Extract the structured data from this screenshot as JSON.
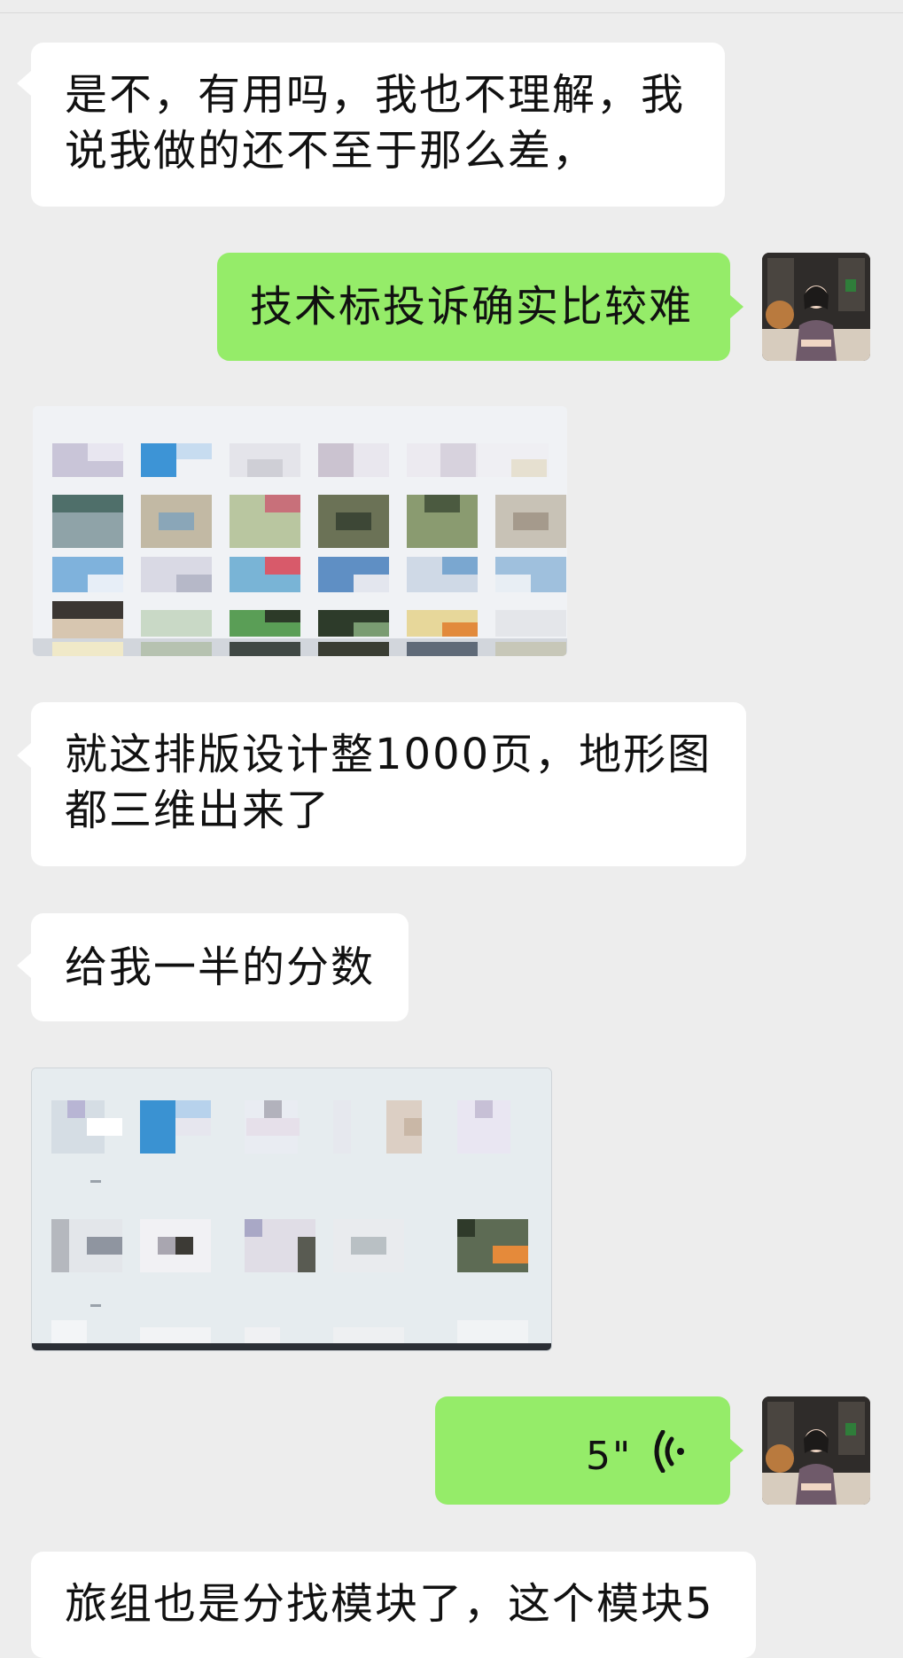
{
  "messages": [
    {
      "side": "in",
      "type": "text",
      "lines": [
        "是不，有用吗，我也不理解，我",
        "说我做的还不至于那么差，"
      ]
    },
    {
      "side": "out",
      "type": "text",
      "lines": [
        "技术标投诉确实比较难"
      ]
    },
    {
      "side": "in",
      "type": "image"
    },
    {
      "side": "in",
      "type": "text",
      "lines": [
        "就这排版设计整1000页，地形图",
        "都三维出来了"
      ]
    },
    {
      "side": "in",
      "type": "text",
      "lines": [
        "给我一半的分数"
      ]
    },
    {
      "side": "in",
      "type": "image"
    },
    {
      "side": "out",
      "type": "voice",
      "duration": "5\""
    },
    {
      "side": "in",
      "type": "text",
      "lines": [
        "旅组也是分找模块了，这个模块5"
      ]
    }
  ],
  "colors": {
    "background": "#ededed",
    "incoming_bubble": "#ffffff",
    "outgoing_bubble": "#95ec69"
  },
  "icons": {
    "voice": "voice-wave-icon",
    "avatar": "user-avatar"
  }
}
